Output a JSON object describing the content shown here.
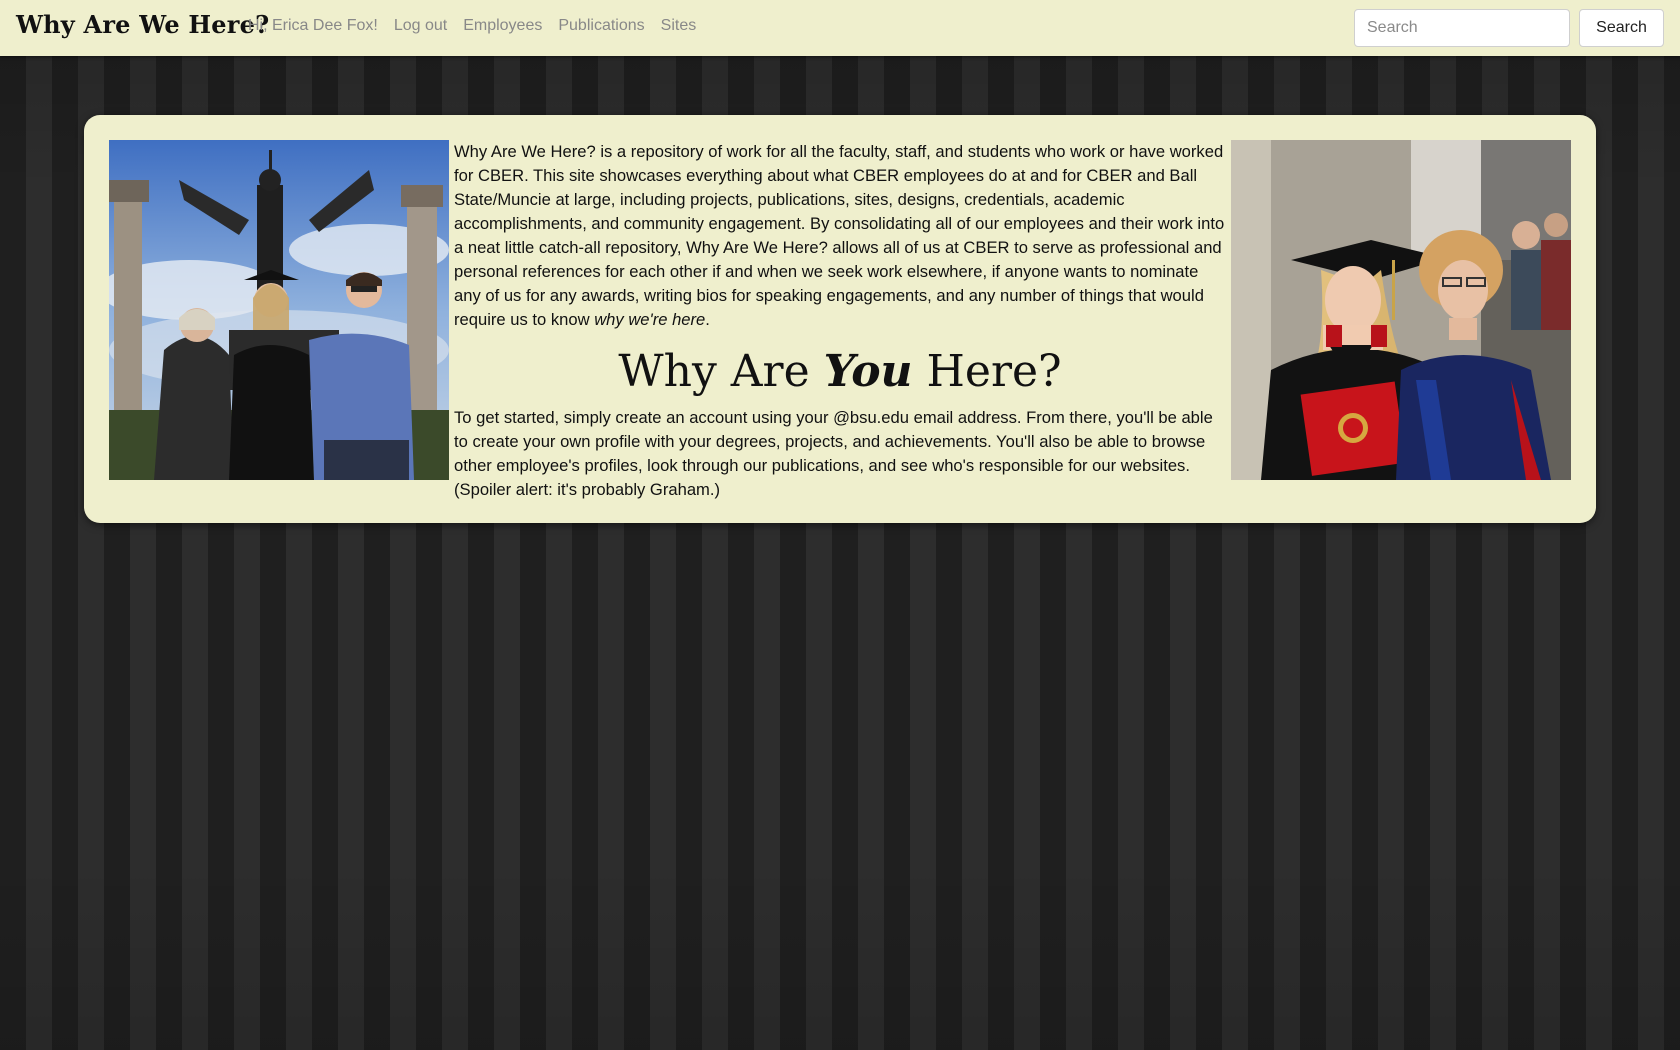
{
  "navbar": {
    "brand": "Why Are We Here?",
    "links": [
      {
        "label": "Hi, Erica Dee Fox!"
      },
      {
        "label": "Log out"
      },
      {
        "label": "Employees"
      },
      {
        "label": "Publications"
      },
      {
        "label": "Sites"
      }
    ],
    "search": {
      "placeholder": "Search",
      "value": "",
      "button_label": "Search"
    }
  },
  "main": {
    "intro_text": "Why Are We Here? is a repository of work for all the faculty, staff, and students who work or have worked for CBER. This site showcases everything about what CBER employees do at and for CBER and Ball State/Muncie at large, including projects, publications, sites, designs, credentials, academic accomplishments, and community engagement. By consolidating all of our employees and their work into a neat little catch-all repository, Why Are We Here? allows all of us at CBER to serve as professional and personal references for each other if and when we seek work elsewhere, if anyone wants to nominate any of us for any awards, writing bios for speaking engagements, and any number of things that would require us to know ",
    "intro_emphasis": "why we're here",
    "intro_end": ".",
    "heading_before": "Why Are ",
    "heading_emphasis": "You",
    "heading_after": " Here?",
    "body_text": "To get started, simply create an account using your @bsu.edu email address. From there, you'll be able to create your own profile with your degrees, projects, and achievements. You'll also be able to browse other employee's profiles, look through our publications, and see who's responsible for our websites. (Spoiler alert: it's probably Graham.)"
  },
  "colors": {
    "navbar_bg": "#efefcd",
    "panel_bg": "#efefcd",
    "page_bg": "#262626",
    "link_gray": "#888888"
  }
}
